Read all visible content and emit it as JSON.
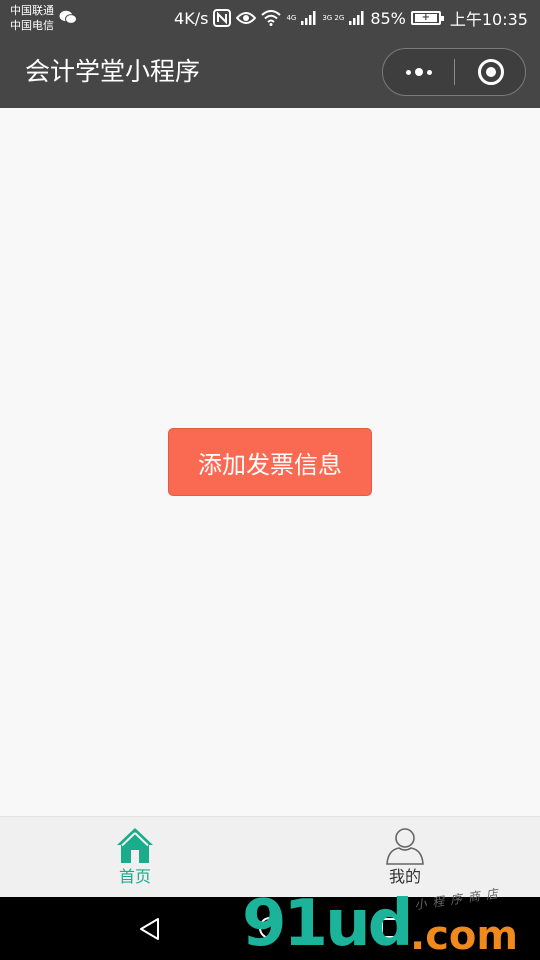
{
  "status_bar": {
    "carrier_1": "中国联通",
    "carrier_2": "中国电信",
    "speed": "4K/s",
    "network_a": "4G",
    "network_b": "3G 2G",
    "battery": "85%",
    "time": "上午10:35"
  },
  "navbar": {
    "title": "会计学堂小程序",
    "background": "#464646"
  },
  "main": {
    "add_button_label": "添加发票信息",
    "add_button_color": "#fa6a53"
  },
  "tabbar": {
    "tabs": [
      {
        "label": "首页",
        "icon": "home-icon",
        "active": true
      },
      {
        "label": "我的",
        "icon": "user-icon",
        "active": false
      }
    ],
    "active_color": "#1aad8c"
  },
  "watermark": {
    "logo": "91ud",
    "domain": ".com",
    "tagline": "小程序商店"
  }
}
